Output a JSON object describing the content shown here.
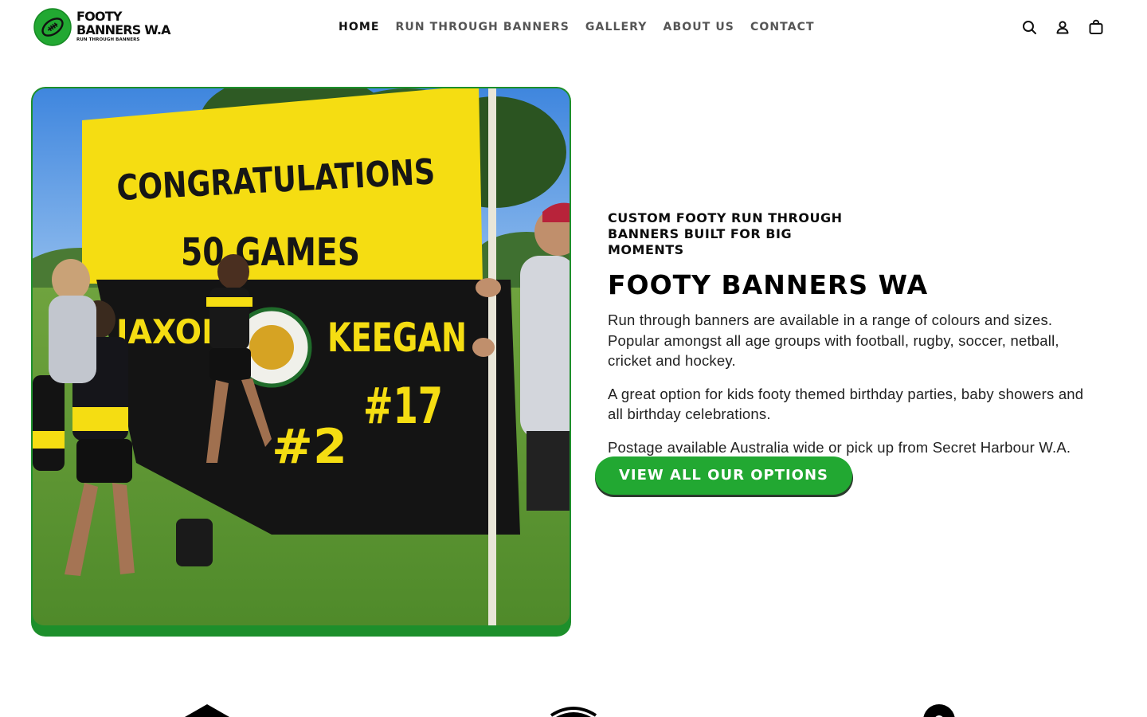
{
  "header": {
    "logo": {
      "line1": "FOOTY",
      "line2": "BANNERS W.A",
      "tagline": "RUN THROUGH BANNERS",
      "brand_green": "#22a832"
    },
    "nav": [
      {
        "label": "HOME",
        "active": true
      },
      {
        "label": "RUN THROUGH BANNERS",
        "active": false
      },
      {
        "label": "GALLERY",
        "active": false
      },
      {
        "label": "ABOUT US",
        "active": false
      },
      {
        "label": "CONTACT",
        "active": false
      }
    ],
    "icons": [
      "search-icon",
      "account-icon",
      "cart-icon"
    ]
  },
  "hero": {
    "image_icon": "hero-photo",
    "banner_text": {
      "line1": "CONGRATULATIONS",
      "line2": "50 GAMES",
      "name_left": "JAXON",
      "name_right": "KEEGAN",
      "number_right": "#17",
      "number_left": "#2"
    },
    "eyebrow": "CUSTOM FOOTY RUN THROUGH BANNERS BUILT FOR BIG MOMENTS",
    "title": "FOOTY BANNERS WA",
    "paragraph1": "Run through banners are available in a range of colours and sizes. Popular amongst all age groups with football, rugby, soccer, netball, cricket and hockey.",
    "paragraph2": "A great option for kids footy themed birthday parties, baby showers and all birthday celebrations.",
    "paragraph3": "Postage available Australia wide or pick up from Secret Harbour W.A.",
    "cta_label": "VIEW ALL OUR OPTIONS",
    "frame_color": "#1d8f2b",
    "cta_color": "#22a832"
  },
  "features": {
    "icons": [
      "house-icon",
      "shield-icon",
      "badge-icon"
    ]
  }
}
